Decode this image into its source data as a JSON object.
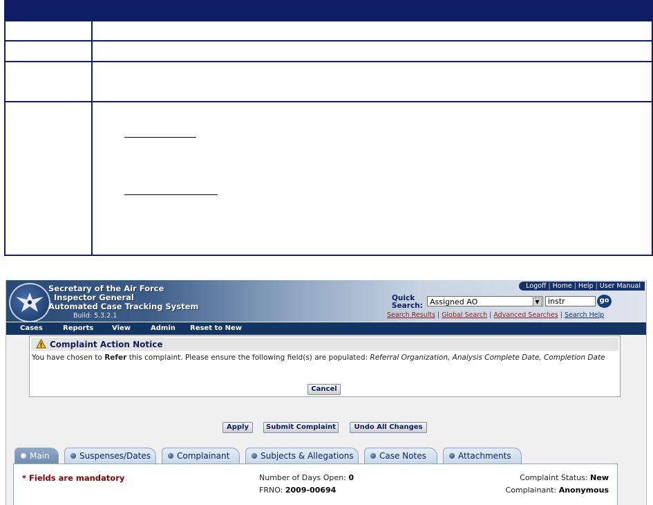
{
  "app": {
    "title_line1": "Secretary of the Air Force",
    "title_line2": "Inspector General",
    "title_line3": "Automated Case Tracking System",
    "build": "Build: 5.3.2.1"
  },
  "top_links": [
    "Logoff",
    "Home",
    "Help",
    "User Manual"
  ],
  "quick_search": {
    "label_line1": "Quick",
    "label_line2": "Search:",
    "selected": "Assigned AO",
    "input_value": "instr",
    "go_label": "go",
    "links": [
      "Search Results",
      "Global Search",
      "Advanced Searches",
      "Search Help"
    ]
  },
  "menu": [
    "Cases",
    "Reports",
    "View",
    "Admin",
    "Reset to New"
  ],
  "notice": {
    "title": "Complaint Action Notice",
    "body_prefix": "You have chosen to ",
    "body_action": "Refer",
    "body_mid": " this complaint. Please ensure the following field(s) are populated: ",
    "body_fields": "Referral Organization, Analysis Complete Date, Completion Date",
    "cancel_label": "Cancel"
  },
  "actions": {
    "apply": "Apply",
    "submit": "Submit Complaint",
    "undo": "Undo All Changes"
  },
  "tabs": [
    "Main",
    "Suspenses/Dates",
    "Complainant",
    "Subjects & Allegations",
    "Case Notes",
    "Attachments"
  ],
  "main": {
    "mandatory_note": "* Fields are mandatory",
    "days_open_label": "Number of Days Open:",
    "days_open_value": "0",
    "frno_label": "FRNO:",
    "frno_value": "2009-00694",
    "status_label": "Complaint Status:",
    "status_value": "New",
    "complainant_label": "Complainant:",
    "complainant_value": "Anonymous"
  }
}
